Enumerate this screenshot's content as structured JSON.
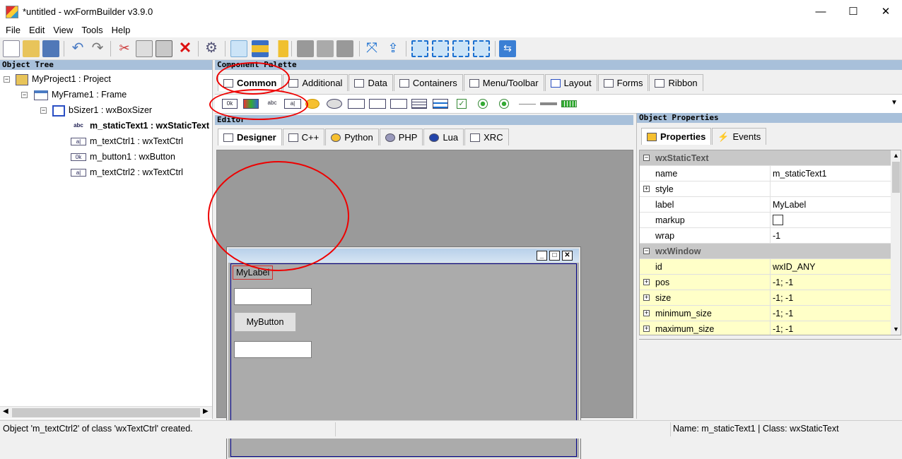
{
  "window": {
    "title": "*untitled - wxFormBuilder v3.9.0",
    "minimize": "—",
    "maximize": "☐",
    "close": "✕"
  },
  "menu": [
    "File",
    "Edit",
    "View",
    "Tools",
    "Help"
  ],
  "panels": {
    "object_tree": "Object Tree",
    "palette": "Component Palette",
    "editor": "Editor",
    "properties": "Object Properties"
  },
  "tree": [
    {
      "label": "MyProject1 : Project",
      "icon": "project-icon"
    },
    {
      "label": "MyFrame1 : Frame",
      "icon": "frame-icon"
    },
    {
      "label": "bSizer1 : wxBoxSizer",
      "icon": "boxsizer-icon"
    },
    {
      "label": "m_staticText1 : wxStaticText",
      "icon": "abc",
      "bold": true
    },
    {
      "label": "m_textCtrl1 : wxTextCtrl",
      "icon": "a|"
    },
    {
      "label": "m_button1 : wxButton",
      "icon": "0k"
    },
    {
      "label": "m_textCtrl2 : wxTextCtrl",
      "icon": "a|"
    }
  ],
  "palette_tabs": [
    "Common",
    "Additional",
    "Data",
    "Containers",
    "Menu/Toolbar",
    "Layout",
    "Forms",
    "Ribbon"
  ],
  "palette_items": [
    "0k",
    "abc",
    "a|"
  ],
  "editor_tabs": [
    "Designer",
    "C++",
    "Python",
    "PHP",
    "Lua",
    "XRC"
  ],
  "design": {
    "label": "MyLabel",
    "button": "MyButton"
  },
  "prop_tabs": [
    "Properties",
    "Events"
  ],
  "properties": [
    {
      "name": "wxStaticText",
      "value": "",
      "cat": true
    },
    {
      "name": "name",
      "value": "m_staticText1"
    },
    {
      "name": "style",
      "value": "",
      "exp": true
    },
    {
      "name": "label",
      "value": "MyLabel"
    },
    {
      "name": "markup",
      "value": "",
      "check": true
    },
    {
      "name": "wrap",
      "value": "-1"
    },
    {
      "name": "wxWindow",
      "value": "",
      "cat": true
    },
    {
      "name": "id",
      "value": "wxID_ANY",
      "yel": true
    },
    {
      "name": "pos",
      "value": "-1; -1",
      "exp": true,
      "yel": true
    },
    {
      "name": "size",
      "value": "-1; -1",
      "exp": true,
      "yel": true
    },
    {
      "name": "minimum_size",
      "value": "-1; -1",
      "exp": true,
      "yel": true
    },
    {
      "name": "maximum_size",
      "value": "-1; -1",
      "exp": true,
      "yel": true
    }
  ],
  "status": {
    "left": "Object 'm_textCtrl2' of class 'wxTextCtrl' created.",
    "right": "Name: m_staticText1 | Class: wxStaticText"
  }
}
